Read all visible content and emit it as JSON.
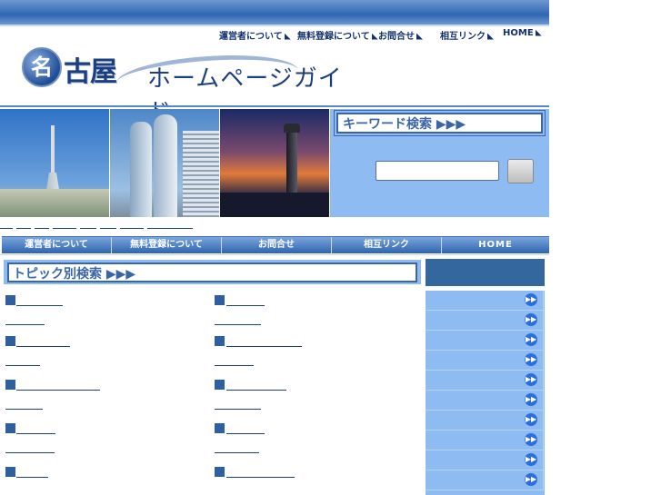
{
  "header": {
    "links": [
      {
        "label": "運営者について"
      },
      {
        "label": "無料登録について"
      },
      {
        "label": "お問合せ"
      },
      {
        "label": "相互リンク"
      },
      {
        "label": "HOME"
      }
    ]
  },
  "logo": {
    "circle_char": "名",
    "city": "古屋",
    "tagline": "ホームページガイド"
  },
  "keyword_search": {
    "heading": "キーワード検索 ▶▶▶",
    "input_value": ""
  },
  "navbar": {
    "items": [
      {
        "label": "運営者について"
      },
      {
        "label": "無料登録について"
      },
      {
        "label": "お問合せ"
      },
      {
        "label": "相互リンク"
      },
      {
        "label": "HOME"
      }
    ]
  },
  "topic_search": {
    "heading": "トピック別検索 ▶▶▶"
  },
  "sidebar": {
    "arrow_icon": "double-arrow-icon",
    "item_count": 10
  },
  "colors": {
    "brand_blue": "#2f64ae",
    "panel_blue": "#8ebbf2",
    "dark_blue": "#35679f"
  }
}
